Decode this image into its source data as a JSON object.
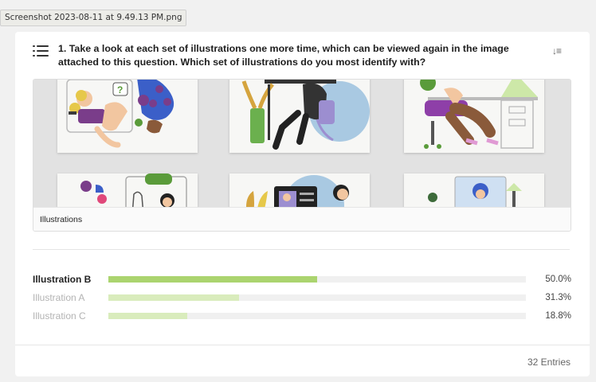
{
  "tooltip": {
    "filename": "Screenshot 2023-08-11 at 9.49.13 PM.png"
  },
  "colors": {
    "accent": "#a9d46b",
    "bar_primary": "#abd46f",
    "bar_secondary": "#d9ecbc",
    "track": "#f0f0f0"
  },
  "question": {
    "icon": "list-icon",
    "sort_icon": "sort-descending-icon",
    "text": "1. Take a look at each set of illustrations one more time, which can be viewed again in the image attached to this question. Which set of illustrations do you most identify with?"
  },
  "image": {
    "caption": "Illustrations"
  },
  "results": [
    {
      "label": "Illustration B",
      "value": 50.0,
      "display": "50.0%",
      "top": true
    },
    {
      "label": "Illustration A",
      "value": 31.3,
      "display": "31.3%",
      "top": false
    },
    {
      "label": "Illustration C",
      "value": 18.8,
      "display": "18.8%",
      "top": false
    }
  ],
  "footer": {
    "entries": "32 Entries"
  }
}
